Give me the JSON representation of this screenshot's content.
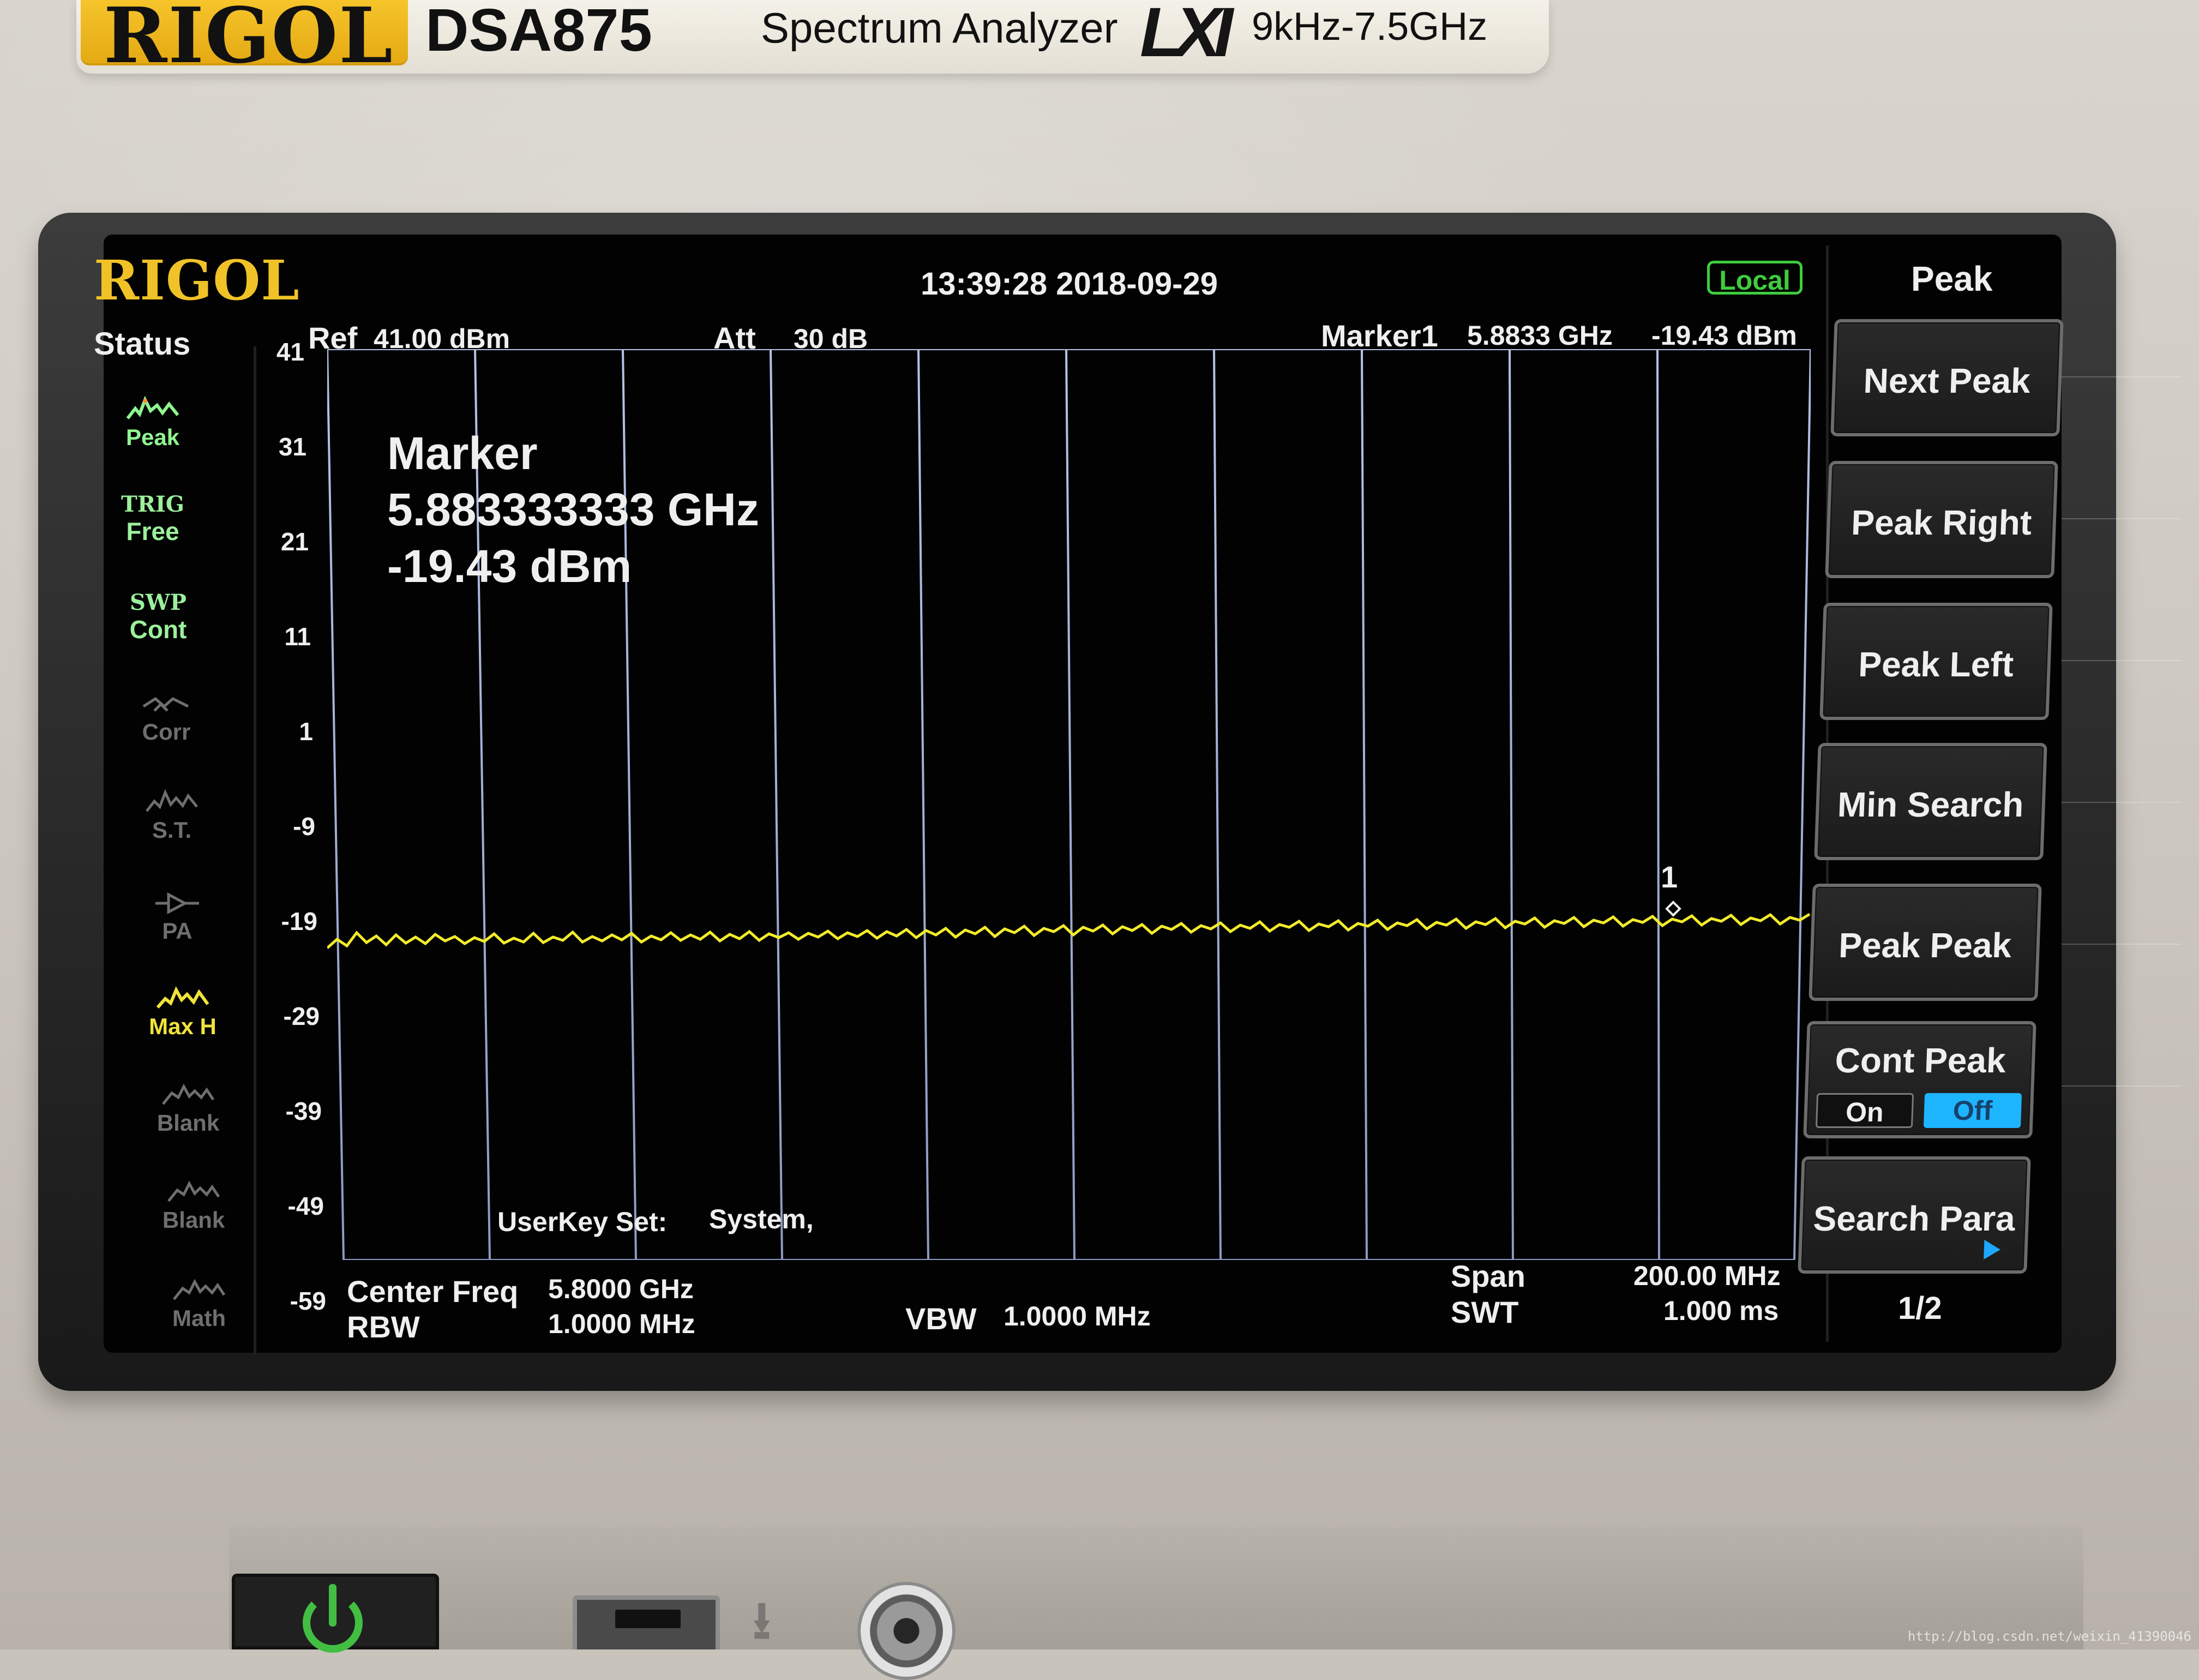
{
  "device": {
    "brand": "RIGOL",
    "model": "DSA875",
    "type": "Spectrum Analyzer",
    "lxi": "LXI",
    "range": "9kHz-7.5GHz"
  },
  "screen": {
    "logo": "RIGOL",
    "datetime": "13:39:28 2018-09-29",
    "local_badge": "Local",
    "status_title": "Status",
    "status_items": [
      {
        "label": "Peak"
      },
      {
        "label_top": "TRIG",
        "label_bottom": "Free"
      },
      {
        "label_top": "SWP",
        "label_bottom": "Cont"
      },
      {
        "label": "Corr"
      },
      {
        "label": "S.T."
      },
      {
        "label": "PA"
      },
      {
        "label": "Max H"
      },
      {
        "label": "Blank"
      },
      {
        "label": "Blank"
      },
      {
        "label": "Math"
      }
    ],
    "top_info": {
      "ref_label": "Ref",
      "ref_value": "41.00 dBm",
      "att_label": "Att",
      "att_value": "30 dB",
      "marker_label": "Marker1",
      "marker_freq": "5.8833 GHz",
      "marker_amp": "-19.43 dBm"
    },
    "y_axis": [
      "41",
      "31",
      "21",
      "11",
      "1",
      "-9",
      "-19",
      "-29",
      "-39",
      "-49",
      "-59"
    ],
    "marker_readout": {
      "title": "Marker",
      "frequency": "5.883333333 GHz",
      "amplitude": "-19.43 dBm"
    },
    "marker_number": "1",
    "userkey_label": "UserKey Set:",
    "userkey_value": "System,",
    "bottom_info": {
      "center_label": "Center Freq",
      "center_value": "5.8000 GHz",
      "rbw_label": "RBW",
      "rbw_value": "1.0000 MHz",
      "vbw_label": "VBW",
      "vbw_value": "1.0000 MHz",
      "span_label": "Span",
      "span_value": "200.00 MHz",
      "swt_label": "SWT",
      "swt_value": "1.000 ms"
    },
    "menu": {
      "title": "Peak",
      "buttons": [
        "Next Peak",
        "Peak Right",
        "Peak Left",
        "Min Search",
        "Peak Peak"
      ],
      "cont_peak": {
        "label": "Cont Peak",
        "on": "On",
        "off": "Off"
      },
      "search_para": "Search Para",
      "page": "1/2"
    }
  },
  "hardware": {
    "watermark": "http://blog.csdn.net/weixin_41390046"
  },
  "colors": {
    "trace": "#f3ec2b",
    "grid": "#a7b4d6",
    "highlight": "#1eb5ff",
    "status_active": "#8ff58f",
    "status_yellow": "#f0e33a"
  }
}
